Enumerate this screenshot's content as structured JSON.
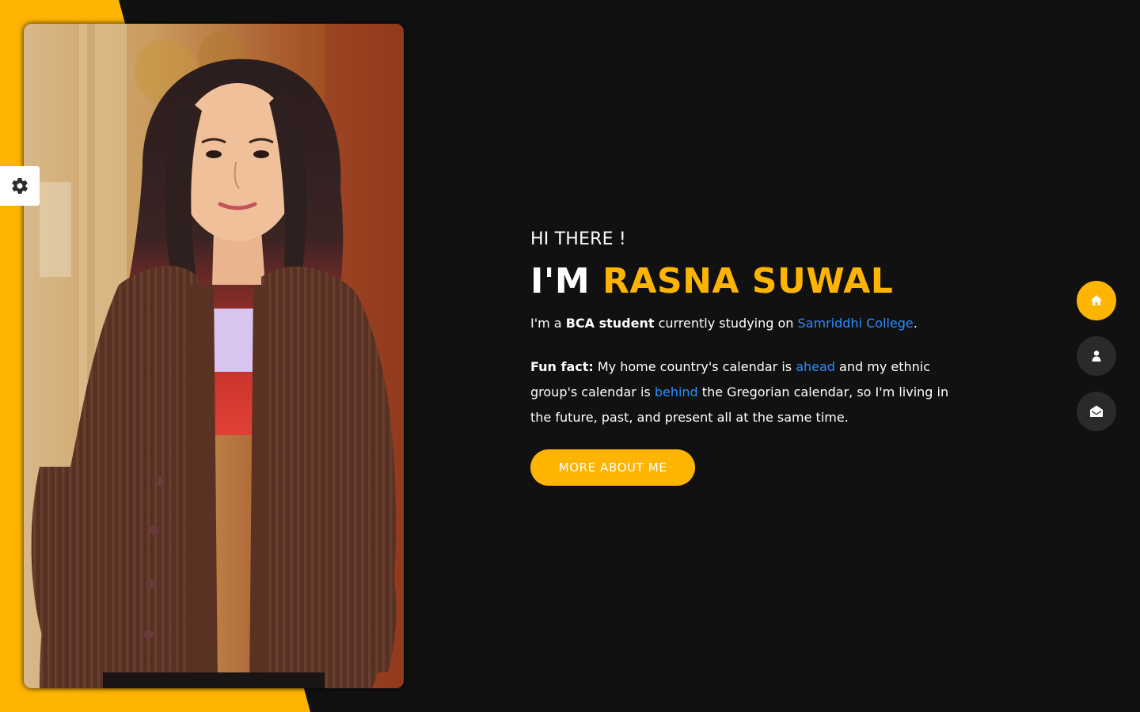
{
  "colors": {
    "accent": "#ffb400",
    "background": "#111111",
    "link": "#2b8cff",
    "nav_inactive": "#2b2a2a"
  },
  "photo": {
    "icon": "portrait-photo"
  },
  "style_switcher": {
    "icon": "gear-icon"
  },
  "hero": {
    "greeting": "HI THERE !",
    "name_prefix": "I'M ",
    "name": "RASNA SUWAL",
    "intro": {
      "part1": "I'm a ",
      "bold": "BCA student",
      "part2": " currently studying on ",
      "link": "Samriddhi College",
      "part3": "."
    },
    "fun_fact": {
      "label": "Fun fact:",
      "part1": " My home country's calendar is ",
      "link1": "ahead",
      "part2": " and my ethnic group's calendar is ",
      "link2": "behind",
      "part3": " the Gregorian calendar, so I'm living in the future, past, and present all at the same time."
    },
    "button_label": "MORE ABOUT ME"
  },
  "nav": {
    "items": [
      {
        "icon": "home-icon",
        "active": true
      },
      {
        "icon": "user-icon",
        "active": false
      },
      {
        "icon": "envelope-open-icon",
        "active": false
      }
    ]
  }
}
